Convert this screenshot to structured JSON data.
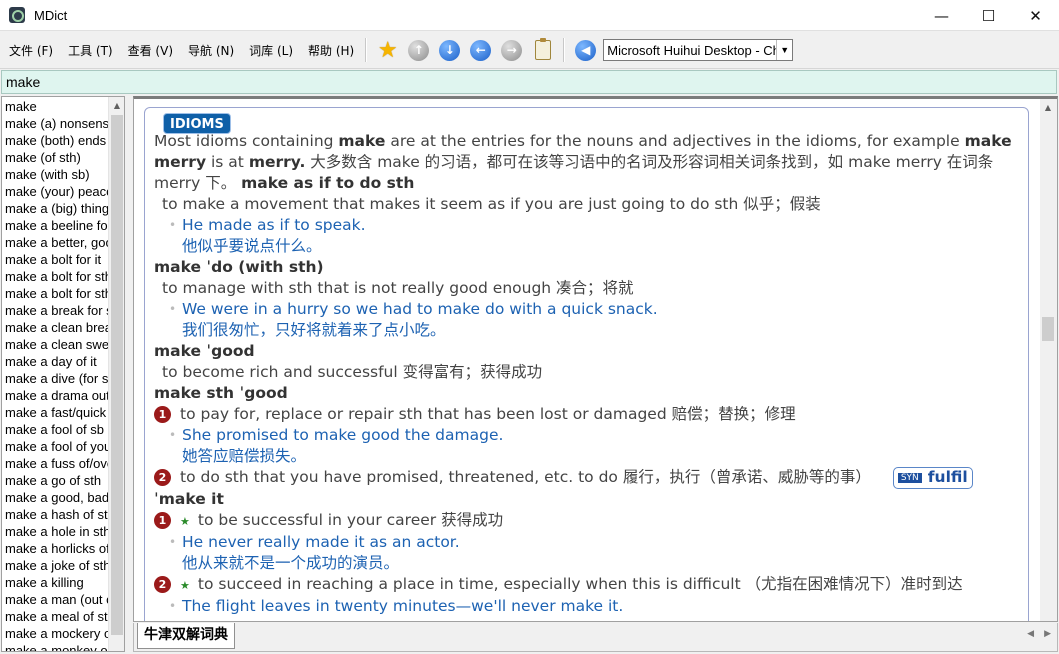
{
  "window": {
    "title": "MDict",
    "minimize": "—",
    "maximize": "☐",
    "close": "✕"
  },
  "menu": [
    "文件 (F)",
    "工具 (T)",
    "查看 (V)",
    "导航 (N)",
    "词库 (L)",
    "帮助 (H)"
  ],
  "toolbar": {
    "voice": "Microsoft Huihui Desktop - Chinese (Simplified)"
  },
  "search": {
    "value": "make"
  },
  "wordlist": [
    "make",
    "make (a) nonsense of sth",
    "make (both) ends meet",
    "make (of sth)",
    "make (with sb)",
    "make (your) peace with sb",
    "make a (big) thing of sth",
    "make a beeline for sb/sth",
    "make a better, good, etc. job of sth",
    "make a bolt for it",
    "make a bolt for sth",
    "make a bolt for sth",
    "make a break for sth/it",
    "make a clean breast of sth",
    "make a clean sweep of sth",
    "make a day of it",
    "make a dive (for sth)",
    "make a drama out of sth",
    "make a fast/quick buck",
    "make a fool of sb",
    "make a fool of yourself",
    "make a fuss of/over sb",
    "make a go of sth",
    "make a good, bad, etc. fist of sth",
    "make a hash of sth",
    "make a hole in sth",
    "make a horlicks of sth",
    "make a joke of sth",
    "make a killing",
    "make a man (out of sb)",
    "make a meal of sth",
    "make a mockery of sth",
    "make a monkey out of sb"
  ],
  "entry": {
    "badge": "IDIOMS",
    "intro_1": "Most idioms containing ",
    "intro_make": "make",
    "intro_2": " are at the entries for the nouns and adjectives in the idioms, for example ",
    "intro_merry": "make merry",
    "intro_3": " is at ",
    "intro_merry2": "merry.",
    "intro_zh": " 大多数含 make 的习语，都可在该等习语中的名词及形容词相关词条找到，如 make merry 在词条 merry 下。 ",
    "i1_head": "make as if to do sth",
    "i1_def": "to make a movement that makes it seem as if you are just going to do sth 似乎；假装",
    "i1_ex": "He made as if to speak.",
    "i1_zh": "他似乎要说点什么。",
    "i2_head": "make ˈdo (with sth)",
    "i2_def": "to manage with sth that is not really good enough 凑合；将就",
    "i2_ex": "We were in a hurry so we had to make do with a quick snack.",
    "i2_zh": "我们很匆忙，只好将就着来了点小吃。",
    "i3_head": "make ˈgood",
    "i3_def": "to become rich and successful 变得富有；获得成功",
    "i4_head": "make sth ˈgood",
    "i4_s1_num": "1",
    "i4_s1_def": "to pay for, replace or repair sth that has been lost or damaged 赔偿；替换；修理",
    "i4_s1_ex": "She promised to make good the damage.",
    "i4_s1_zh": "她答应赔偿损失。",
    "i4_s2_num": "2",
    "i4_s2_def": "to do sth that you have promised, threatened, etc. to do 履行，执行（曾承诺、威胁等的事）",
    "i4_s2_syn_tag": "SYN",
    "i4_s2_syn": "fulfil",
    "i5_head": "ˈmake it",
    "i5_s1_num": "1",
    "i5_star": "★",
    "i5_s1_def": "to be successful in your career 获得成功",
    "i5_s1_ex": "He never really made it as an actor.",
    "i5_s1_zh": "他从来就不是一个成功的演员。",
    "i5_s2_num": "2",
    "i5_s2_def": "to succeed in reaching a place in time, especially when this is difficult （尤指在困难情况下）准时到达",
    "i5_s2_ex": "The flight leaves in twenty minutes—we'll never make it."
  },
  "tab": {
    "label": "牛津双解词典"
  }
}
